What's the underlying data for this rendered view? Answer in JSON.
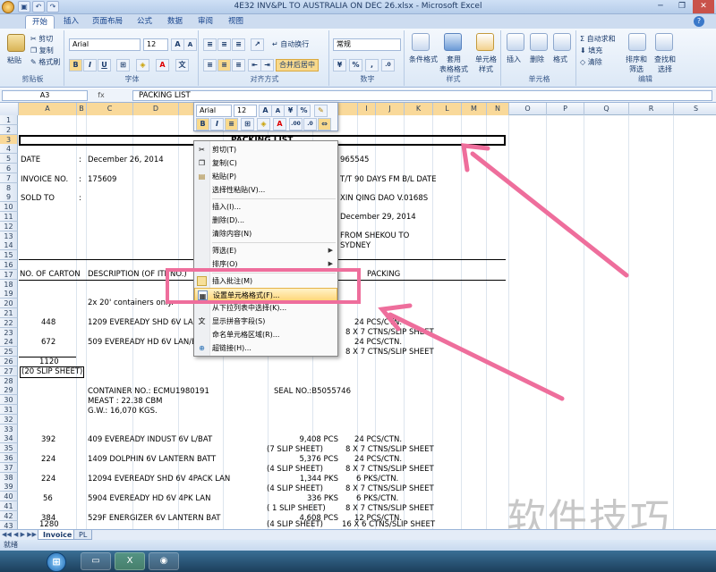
{
  "window": {
    "title": "4E32 INV&PL TO AUSTRALIA ON DEC 26.xlsx - Microsoft Excel",
    "quick_access": [
      "save",
      "undo",
      "redo"
    ]
  },
  "ribbon": {
    "tabs": [
      "开始",
      "插入",
      "页面布局",
      "公式",
      "数据",
      "审阅",
      "视图"
    ],
    "clipboard": {
      "label": "剪贴板",
      "paste": "粘贴",
      "cut": "剪切",
      "copy": "复制",
      "format_painter": "格式刷"
    },
    "font": {
      "label": "字体",
      "name": "Arial",
      "size": "12",
      "bold": "B",
      "italic": "I",
      "underline": "U"
    },
    "alignment": {
      "label": "对齐方式",
      "wrap": "自动换行",
      "merge": "合并后居中"
    },
    "number": {
      "label": "数字",
      "format": "常规",
      "percent": "%",
      "comma": ","
    },
    "styles": {
      "label": "样式",
      "conditional": "条件格式",
      "table": "套用\n表格格式",
      "cell_styles": "单元格\n样式"
    },
    "cells": {
      "label": "单元格",
      "insert": "插入",
      "delete": "删除",
      "format": "格式"
    },
    "editing": {
      "label": "编辑",
      "autosum": "自动求和",
      "fill": "填充",
      "clear": "清除",
      "sort": "排序和\n筛选",
      "find": "查找和\n选择"
    }
  },
  "formula_bar": {
    "name_box": "A3",
    "fx": "fx",
    "content": "PACKING LIST"
  },
  "columns": [
    "A",
    "B",
    "C",
    "D",
    "E",
    "F",
    "G",
    "H",
    "I",
    "J",
    "K",
    "L",
    "M",
    "N",
    "O",
    "P",
    "Q",
    "R",
    "S"
  ],
  "rows": [
    "1",
    "2",
    "3",
    "4",
    "5",
    "6",
    "7",
    "8",
    "9",
    "10",
    "11",
    "12",
    "13",
    "14",
    "15",
    "16",
    "17",
    "18",
    "19",
    "20",
    "21",
    "22",
    "23",
    "24",
    "25",
    "26",
    "27",
    "28",
    "29",
    "30",
    "31",
    "32",
    "33",
    "34",
    "35",
    "36",
    "37",
    "38",
    "39",
    "40",
    "41",
    "42",
    "43"
  ],
  "cells": {
    "title": "PACKING LIST",
    "date_label": "DATE",
    "date_colon": ":",
    "date_value": "December 26, 2014",
    "ref_no": "965545",
    "invoice_label": "INVOICE NO.",
    "invoice_colon": ":",
    "invoice_value": "175609",
    "terms": "T/T 90 DAYS FM B/L DATE",
    "sold_label": "SOLD TO",
    "sold_colon": ":",
    "vessel": "XIN QING DAO V.0168S",
    "ship_date": "December 29, 2014",
    "route_from": "FROM SHEKOU TO",
    "route_to": "SYDNEY",
    "hdr_cartons": "NO. OF CARTON",
    "hdr_desc": "DESCRIPTION (OF ITE",
    "hdr_desc2": "NO.)",
    "hdr_packing": "PACKING",
    "containers": "2x 20' containers only.",
    "r22_a": "448",
    "r22_c": "1209 EVEREADY SHD 6V LAN/",
    "r22_i": "24  PCS/CTN.",
    "r23_i": "8 X 7  CTNS/SLIP SHEET",
    "r24_a": "672",
    "r24_c": "509 EVEREADY HD 6V LAN/BA",
    "r24_i": "24  PCS/CTN.",
    "r25_i": "8 X 7  CTNS/SLIP SHEET",
    "r26_a": "1120",
    "r27_a": "(20 SLIP SHEET)",
    "container_no": "CONTAINER NO.: ECMU1980191",
    "seal_no": "SEAL NO.:B5055746",
    "meast": "MEAST : 22.38 CBM",
    "gw": "G.W.:  16,070 KGS.",
    "r34_a": "392",
    "r34_c": "409 EVEREADY INDUST 6V L/BAT",
    "r34_h": "9,408 PCS",
    "r34_i": "24  PCS/CTN.",
    "r35_h": "(7 SLIP SHEET)",
    "r35_i": "8 X 7  CTNS/SLIP SHEET",
    "r36_a": "224",
    "r36_c": "1409  DOLPHIN 6V LANTERN BATT",
    "r36_h": "5,376 PCS",
    "r36_i": "24  PCS/CTN.",
    "r37_h": "(4 SLIP SHEET)",
    "r37_i": "8 X 7  CTNS/SLIP SHEET",
    "r38_a": "224",
    "r38_c": "12094 EVEREADY SHD 6V 4PACK LAN",
    "r38_h": "1,344 PKS",
    "r38_i": "6  PKS/CTN.",
    "r39_h": "(4 SLIP SHEET)",
    "r39_i": "8 X 7  CTNS/SLIP SHEET",
    "r40_a": "56",
    "r40_c": "5904 EVEREADY HD 6V 4PK LAN",
    "r40_h": "336 PKS",
    "r40_i": "6  PKS/CTN.",
    "r41_h": "( 1 SLIP SHEET)",
    "r41_i": "8 X 7  CTNS/SLIP SHEET",
    "r42_a": "384",
    "r42_c": "529F ENERGIZER 6V LANTERN BAT",
    "r42_h": "4,608 PCS",
    "r42_i": "12  PCS/CTN.",
    "r43_a": "1280",
    "r43_h": "(4 SLIP SHEET)",
    "r43_i": "16 X 6  CTNS/SLIP SHEET"
  },
  "mini_toolbar": {
    "font": "Arial",
    "size": "12",
    "bold": "B",
    "italic": "I",
    "percent": "%"
  },
  "context_menu": [
    {
      "label": "剪切(T)",
      "icon": "scissors-icon"
    },
    {
      "label": "复制(C)",
      "icon": "copy-icon"
    },
    {
      "label": "粘贴(P)",
      "icon": "paste-icon"
    },
    {
      "label": "选择性粘贴(V)...",
      "icon": ""
    },
    {
      "label": "插入(I)...",
      "icon": ""
    },
    {
      "label": "删除(D)...",
      "icon": ""
    },
    {
      "label": "清除内容(N)",
      "icon": ""
    },
    {
      "label": "筛选(E)",
      "icon": ""
    },
    {
      "label": "排序(O)",
      "icon": ""
    },
    {
      "label": "插入批注(M)",
      "icon": "comment-icon"
    },
    {
      "label": "设置单元格格式(F)...",
      "icon": "format-cells-icon"
    },
    {
      "label": "从下拉列表中选择(K)...",
      "icon": ""
    },
    {
      "label": "显示拼音字段(S)",
      "icon": "phonetic-icon"
    },
    {
      "label": "命名单元格区域(R)...",
      "icon": ""
    },
    {
      "label": "超链接(H)...",
      "icon": "hyperlink-icon"
    }
  ],
  "sheet_tabs": [
    "Invoice",
    "PL"
  ],
  "status": "就绪",
  "watermark": "软件技巧",
  "colors": {
    "annotation_pink": "#ee6e9c",
    "highlight": "#ffd77a",
    "selected_header": "#f9d99a"
  }
}
